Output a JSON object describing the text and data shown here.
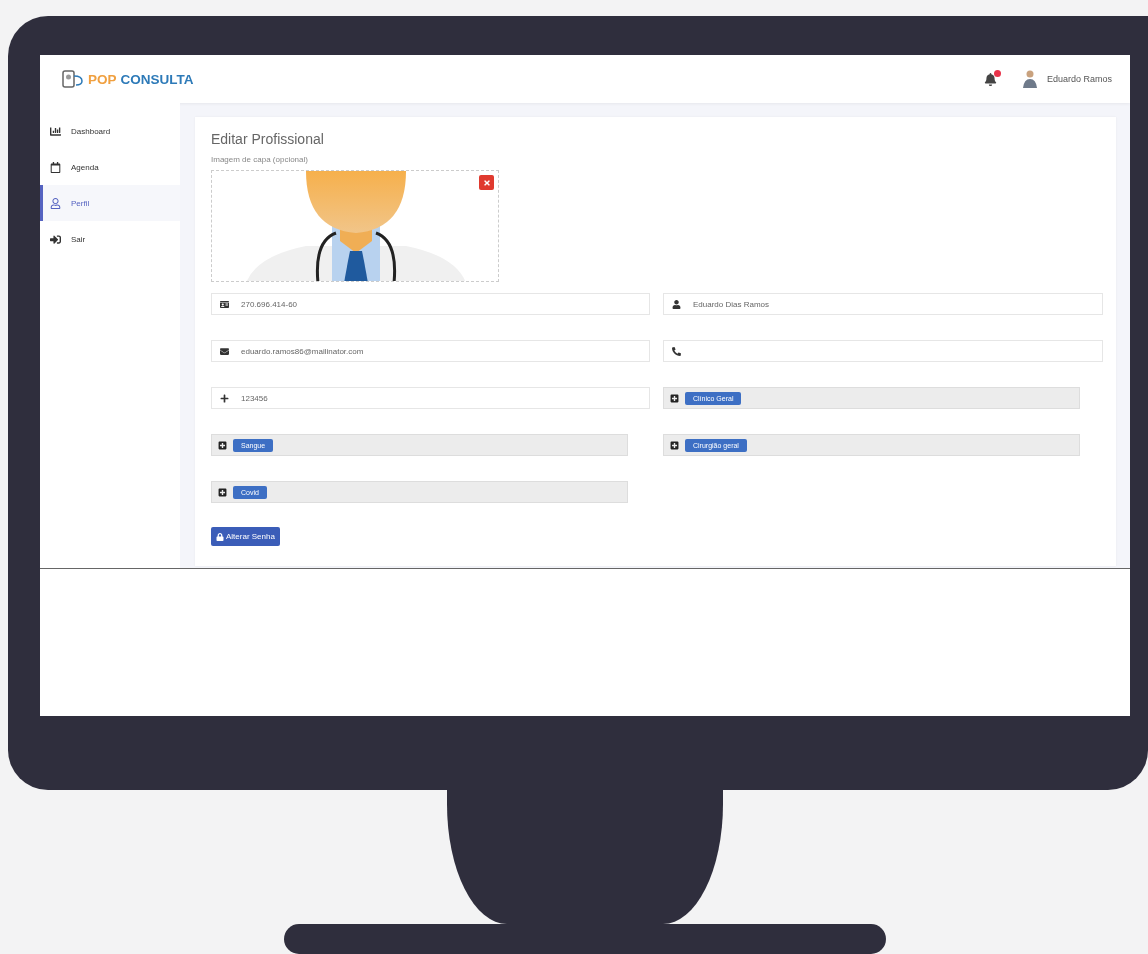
{
  "header": {
    "logo": {
      "part_1": "POP",
      "part_2": "CONSULTA"
    },
    "user_name": "Eduardo Ramos"
  },
  "sidebar": {
    "items": [
      {
        "label": "Dashboard",
        "selected": false
      },
      {
        "label": "Agenda",
        "selected": false
      },
      {
        "label": "Perfil",
        "selected": true
      },
      {
        "label": "Sair",
        "selected": false
      }
    ]
  },
  "form": {
    "title": "Editar Profissional",
    "image_label": "Imagem de capa (opcional)",
    "fields": [
      {
        "kind": "input",
        "value": "270.696.414-60"
      },
      {
        "kind": "input",
        "value": "Eduardo Dias Ramos"
      },
      {
        "kind": "input",
        "value": "eduardo.ramos86@mailinator.com"
      },
      {
        "kind": "input"
      },
      {
        "kind": "input",
        "value": "123456"
      },
      {
        "kind": "tags",
        "tags": [
          "Clínico Geral"
        ]
      },
      {
        "kind": "tags",
        "tags": [
          "Sangue"
        ]
      },
      {
        "kind": "tags",
        "tags": [
          "Cirurgião geral"
        ]
      },
      {
        "kind": "tags",
        "tags": [
          "Covid"
        ]
      }
    ],
    "button": "Alterar Senha"
  }
}
